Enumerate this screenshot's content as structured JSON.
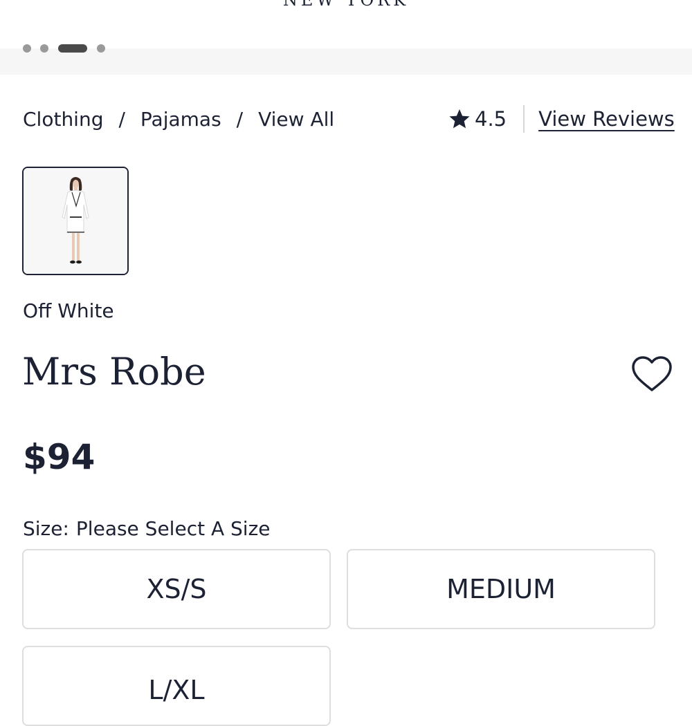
{
  "header": {
    "brand_city": "NEW YORK"
  },
  "breadcrumb": {
    "items": [
      "Clothing",
      "Pajamas",
      "View All"
    ],
    "separator": "/"
  },
  "rating": {
    "value": "4.5",
    "reviews_link": "View Reviews"
  },
  "swatch": {
    "color_name": "Off White"
  },
  "product": {
    "title": "Mrs Robe",
    "price": "$94"
  },
  "size": {
    "label": "Size:",
    "prompt": "Please Select A Size",
    "options": [
      "XS/S",
      "MEDIUM",
      "L/XL"
    ]
  },
  "colors": {
    "text": "#1c2233",
    "border": "#dedede",
    "strip": "#f6f6f6"
  }
}
